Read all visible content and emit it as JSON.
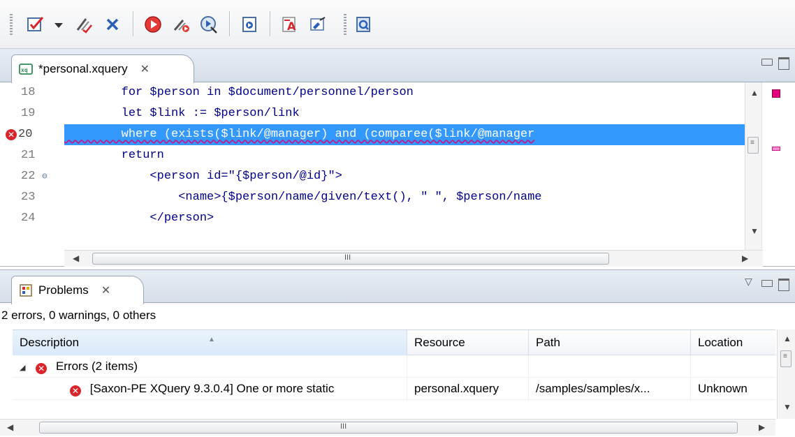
{
  "toolbar": {
    "buttons": [
      {
        "icon": "validate-icon"
      },
      {
        "icon": "dropdown-arrow-icon"
      },
      {
        "icon": "validate-with-icon"
      },
      {
        "icon": "clear-markers-icon"
      },
      {
        "icon": "run-transformation-icon"
      },
      {
        "icon": "configure-transformation-icon"
      },
      {
        "icon": "debug-scenario-icon"
      },
      {
        "icon": "xquery-builder-icon"
      },
      {
        "icon": "format-indent-icon"
      },
      {
        "icon": "edit-attributes-icon"
      },
      {
        "icon": "xslt-xquery-debugger-icon"
      }
    ]
  },
  "editor": {
    "tab_label": "*personal.xquery",
    "lines": [
      {
        "n": "18",
        "text": "        for $person in $document/personnel/person"
      },
      {
        "n": "19",
        "text": "        let $link := $person/link"
      },
      {
        "n": "20",
        "text": "        where (exists($link/@manager) and (comparee($link/@manager"
      },
      {
        "n": "21",
        "text": "        return"
      },
      {
        "n": "22",
        "text": "            <person id=\"{$person/@id}\">"
      },
      {
        "n": "23",
        "text": "                <name>{$person/name/given/text(), \" \", $person/name"
      },
      {
        "n": "24",
        "text": "            </person>"
      }
    ],
    "error_line": "20",
    "hscroll_mark": "III"
  },
  "problems": {
    "tab_label": "Problems",
    "summary": "2 errors, 0 warnings, 0 others",
    "columns": [
      "Description",
      "Resource",
      "Path",
      "Location"
    ],
    "group_label": "Errors (2 items)",
    "rows": [
      {
        "description": "[Saxon-PE XQuery 9.3.0.4] One or more static",
        "resource": "personal.xquery",
        "path": "/samples/samples/x...",
        "location": "Unknown"
      }
    ],
    "hscroll_mark": "III"
  },
  "colors": {
    "selection": "#3399ff",
    "error": "#d9252b",
    "keyword": "#00008b"
  }
}
